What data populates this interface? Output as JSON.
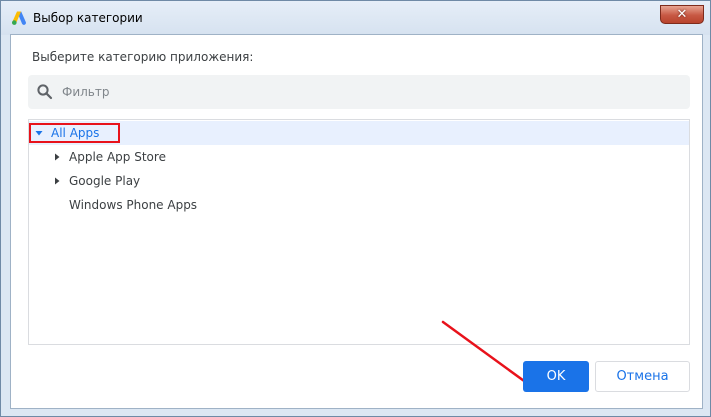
{
  "window": {
    "title": "Выбор категории",
    "close_glyph": "✕"
  },
  "dialog": {
    "prompt": "Выберите категорию приложения:",
    "search": {
      "placeholder": "Фильтр",
      "value": ""
    },
    "tree": [
      {
        "label": "All Apps",
        "expanded": true,
        "selected": true
      },
      {
        "label": "Apple App Store",
        "expanded": false
      },
      {
        "label": "Google Play",
        "expanded": false
      },
      {
        "label": "Windows Phone Apps",
        "expanded": false
      }
    ],
    "ok_label": "OK",
    "cancel_label": "Отмена"
  },
  "colors": {
    "accent": "#1a73e8",
    "annotation_red": "#e8121b",
    "selected_row": "#e8f0fe"
  },
  "icons": [
    "google-ads-logo-icon",
    "search-icon",
    "caret-down-icon",
    "caret-right-icon",
    "close-icon"
  ]
}
